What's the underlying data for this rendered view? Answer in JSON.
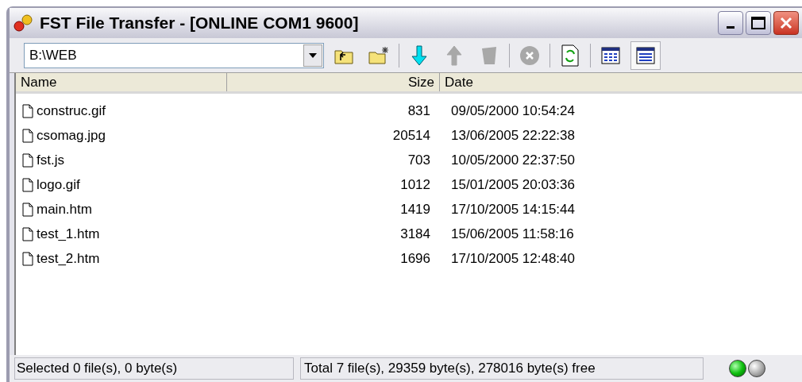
{
  "window": {
    "title": "FST File Transfer - [ONLINE COM1 9600]"
  },
  "toolbar": {
    "path": "B:\\WEB",
    "buttons": [
      {
        "kind": "parent-folder",
        "disabled": false,
        "selected": false
      },
      {
        "kind": "new-folder",
        "disabled": false,
        "selected": false
      },
      {
        "kind": "separator"
      },
      {
        "kind": "download",
        "disabled": false,
        "selected": false
      },
      {
        "kind": "upload",
        "disabled": true,
        "selected": false
      },
      {
        "kind": "delete",
        "disabled": true,
        "selected": false
      },
      {
        "kind": "separator"
      },
      {
        "kind": "cancel",
        "disabled": true,
        "selected": false
      },
      {
        "kind": "separator"
      },
      {
        "kind": "refresh",
        "disabled": false,
        "selected": false
      },
      {
        "kind": "separator"
      },
      {
        "kind": "list-view",
        "disabled": false,
        "selected": false
      },
      {
        "kind": "details-view",
        "disabled": false,
        "selected": true
      }
    ]
  },
  "table": {
    "columns": [
      "Name",
      "Size",
      "Date"
    ],
    "rows": [
      {
        "name": "construc.gif",
        "size": "831",
        "date": "09/05/2000 10:54:24"
      },
      {
        "name": "csomag.jpg",
        "size": "20514",
        "date": "13/06/2005 22:22:38"
      },
      {
        "name": "fst.js",
        "size": "703",
        "date": "10/05/2000 22:37:50"
      },
      {
        "name": "logo.gif",
        "size": "1012",
        "date": "15/01/2005 20:03:36"
      },
      {
        "name": "main.htm",
        "size": "1419",
        "date": "17/10/2005 14:15:44"
      },
      {
        "name": "test_1.htm",
        "size": "3184",
        "date": "15/06/2005 11:58:16"
      },
      {
        "name": "test_2.htm",
        "size": "1696",
        "date": "17/10/2005 12:48:40"
      }
    ]
  },
  "status_bar": {
    "selected": "Selected  0 file(s), 0 byte(s)",
    "total": "Total  7 file(s), 29359 byte(s), 278016 byte(s) free",
    "lights": [
      {
        "on": true
      },
      {
        "on": false
      }
    ]
  }
}
